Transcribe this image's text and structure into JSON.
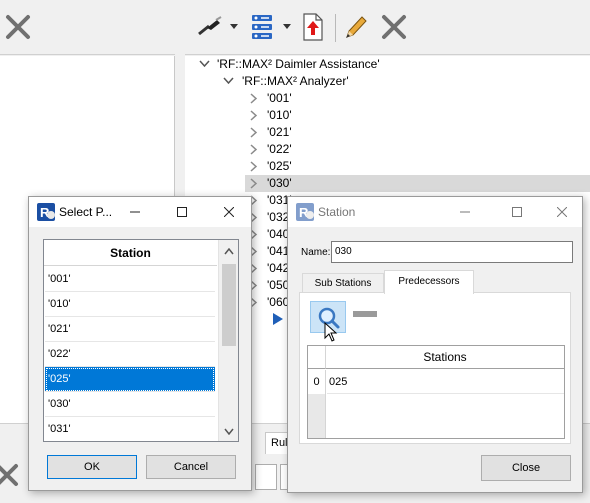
{
  "tree": {
    "root": "'RF::MAX² Daimler Assistance'",
    "child": "'RF::MAX² Analyzer'",
    "items": [
      "'001'",
      "'010'",
      "'021'",
      "'022'",
      "'025'",
      "'030'",
      "'031'",
      "'032'",
      "'040'",
      "'041'",
      "'042'",
      "'050'",
      "'060'"
    ],
    "selected_index": 5
  },
  "partial_tab": "Rul",
  "select_dialog": {
    "title": "Select P...",
    "column_header": "Station",
    "items": [
      "'001'",
      "'010'",
      "'021'",
      "'022'",
      "'025'",
      "'030'",
      "'031'"
    ],
    "selected_index": 4,
    "ok_label": "OK",
    "cancel_label": "Cancel"
  },
  "station_dialog": {
    "title": "Station",
    "name_label": "Name:",
    "name_value": "030",
    "tabs": [
      "Sub Stations",
      "Predecessors"
    ],
    "active_tab": 1,
    "grid_header": "Stations",
    "rows": [
      {
        "index": "0",
        "value": "025"
      }
    ],
    "close_label": "Close"
  },
  "colors": {
    "selection": "#0078d7",
    "tree_selection": "#d9d9d9",
    "delete_icon": "#707070"
  }
}
